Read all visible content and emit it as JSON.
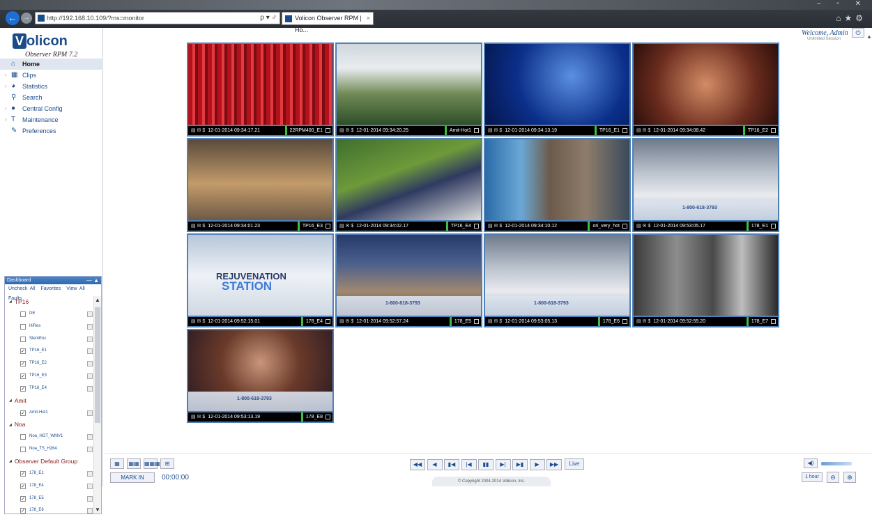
{
  "browser": {
    "url": "http://192.168.10.109/?ms=monitor",
    "tab_title": "Volicon Observer RPM | Ho...",
    "tab_close": "×",
    "search_ctl": "ρ ▾ ♂"
  },
  "app": {
    "brand": "olicon",
    "brand_letter": "V",
    "product": "Observer RPM 7.2",
    "welcome": "Welcome, Admin",
    "session": "Unlimited Session"
  },
  "nav": [
    {
      "label": "Home",
      "icon": "home-icon",
      "glyph": "⌂",
      "active": true
    },
    {
      "label": "Clips",
      "icon": "clips-icon",
      "glyph": "▦",
      "expandable": true
    },
    {
      "label": "Statistics",
      "icon": "statistics-icon",
      "glyph": "◕",
      "expandable": true
    },
    {
      "label": "Search",
      "icon": "search-icon",
      "glyph": "⚲"
    },
    {
      "label": "Central Config",
      "icon": "central-config-icon",
      "glyph": "●",
      "expandable": true
    },
    {
      "label": "Maintenance",
      "icon": "maintenance-icon",
      "glyph": "T",
      "expandable": true
    },
    {
      "label": "Preferences",
      "icon": "preferences-icon",
      "glyph": "✎"
    }
  ],
  "dashboard": {
    "title": "Dashboard",
    "links": [
      "Uncheck All",
      "Favorites",
      "View All Faults"
    ],
    "groups": [
      {
        "name": "TP16",
        "channels": [
          {
            "label": "DE",
            "checked": false
          },
          {
            "label": "HiRes",
            "checked": false
          },
          {
            "label": "StemEnc",
            "checked": false
          },
          {
            "label": "TP16_E1",
            "checked": true
          },
          {
            "label": "TP16_E2",
            "checked": true
          },
          {
            "label": "TP16_E3",
            "checked": true
          },
          {
            "label": "TP16_E4",
            "checked": true
          }
        ]
      },
      {
        "name": "Amit",
        "channels": [
          {
            "label": "Amit-Hot1",
            "checked": true
          }
        ]
      },
      {
        "name": "Noa",
        "channels": [
          {
            "label": "Noa_HOT_WMV1",
            "checked": false
          },
          {
            "label": "Noa_TS_H264",
            "checked": false
          }
        ]
      },
      {
        "name": "Observer Default Group",
        "channels": [
          {
            "label": "178_E1",
            "checked": true
          },
          {
            "label": "178_E4",
            "checked": true
          },
          {
            "label": "178_E5",
            "checked": true
          },
          {
            "label": "178_E6",
            "checked": true
          }
        ]
      }
    ]
  },
  "tiles": [
    {
      "ts": "12-01-2014 09:34:17.21",
      "channel": "22RPM400_E1",
      "scene": "red-curtain"
    },
    {
      "ts": "12-01-2014 09:34:20.25",
      "channel": "Amit-Hot1",
      "scene": "interview-outdoor"
    },
    {
      "ts": "12-01-2014 09:34:13.19",
      "channel": "TP16_E1",
      "scene": "studio-blue"
    },
    {
      "ts": "12-01-2014 09:34:08.42",
      "channel": "TP16_E2",
      "scene": "warm-room"
    },
    {
      "ts": "12-01-2014 09:34:01.23",
      "channel": "TP16_E3",
      "scene": "talk-show"
    },
    {
      "ts": "12-01-2014 09:34:02.17",
      "channel": "TP16_E4",
      "scene": "football"
    },
    {
      "ts": "12-01-2014 09:34:10.12",
      "channel": "ori_very_hot",
      "scene": "interview-indoor"
    },
    {
      "ts": "12-01-2014 09:53:05.17",
      "channel": "178_E1",
      "scene": "bedroom-ad"
    },
    {
      "ts": "12-01-2014 09:52:15.01",
      "channel": "178_E4",
      "scene": "rejuvenation"
    },
    {
      "ts": "12-01-2014 09:52:57.24",
      "channel": "178_E5",
      "scene": "bedroom-man"
    },
    {
      "ts": "12-01-2014 09:53:05.13",
      "channel": "178_E6",
      "scene": "bedroom-ad"
    },
    {
      "ts": "12-01-2014 09:52:55.20",
      "channel": "178_E7",
      "scene": "bw-film"
    },
    {
      "ts": "12-01-2014 09:53:13.19",
      "channel": "178_E8",
      "scene": "woman-ad"
    }
  ],
  "overlays": {
    "rejuvenation_1": "REJUVENATION",
    "rejuvenation_2": "STATION",
    "phone": "1-800-618-3793"
  },
  "controls": {
    "layouts": [
      "▦",
      "▦▦",
      "▦▦▦",
      "⊞"
    ],
    "mark_in": "MARK IN",
    "timer": "00:00:00",
    "playback": [
      "◀◀",
      "◀",
      "▮◀",
      "|◀",
      "▮▮",
      "▶|",
      "▶▮",
      "▶",
      "▶▶"
    ],
    "live": "Live",
    "copyright": "© Copyright 2004-2014 Volicon, Inc.",
    "hour": "1 hour"
  }
}
